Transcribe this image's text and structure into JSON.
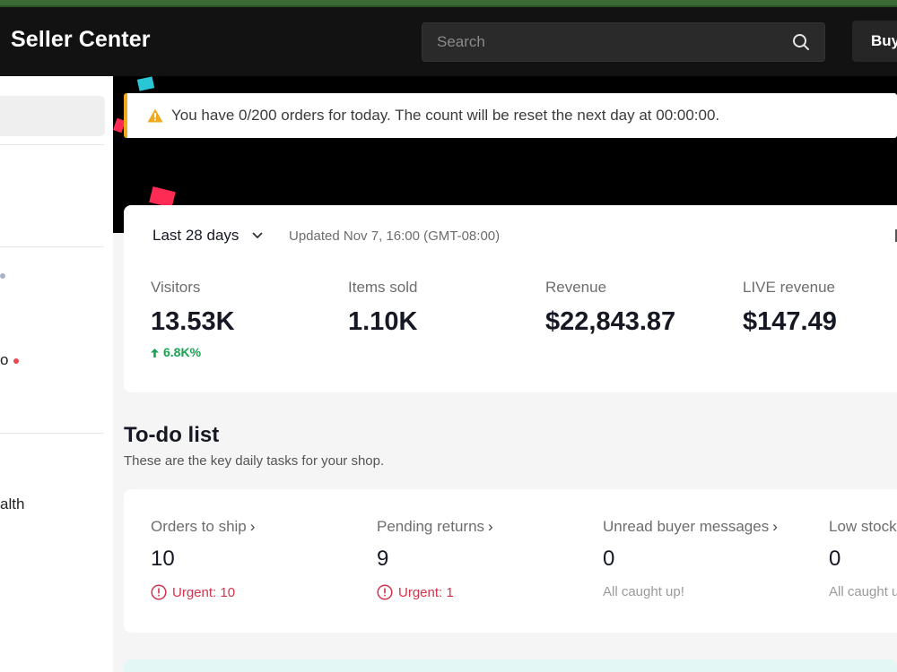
{
  "colors": {
    "topbar": "#121212",
    "accent_strip": "#3a6b34",
    "urgent": "#d5334d",
    "positive": "#1aa352",
    "warning": "#f0a91b",
    "confetti": [
      "#29c6d6",
      "#fe2c55"
    ]
  },
  "header": {
    "title": "Seller Center",
    "search_placeholder": "Search",
    "search_icon": "search-icon",
    "buy_button": "Buy"
  },
  "sidebar": {
    "fragments": [
      "o",
      "alth"
    ]
  },
  "notice": {
    "icon": "warning-icon",
    "text": "You have 0/200 orders for today. The count will be reset the next day at 00:00:00."
  },
  "stats": {
    "period": "Last 28 days",
    "updated": "Updated Nov 7, 16:00 (GMT-08:00)",
    "metrics": [
      {
        "label": "Visitors",
        "value": "13.53K",
        "change": "6.8K%"
      },
      {
        "label": "Items sold",
        "value": "1.10K"
      },
      {
        "label": "Revenue",
        "value": "$22,843.87"
      },
      {
        "label": "LIVE revenue",
        "value": "$147.49"
      }
    ]
  },
  "todo": {
    "title": "To-do list",
    "subtitle": "These are the key daily tasks for your shop.",
    "tasks": [
      {
        "label": "Orders to ship",
        "count": "10",
        "note": "Urgent: 10"
      },
      {
        "label": "Pending returns",
        "count": "9",
        "note": "Urgent: 1"
      },
      {
        "label": "Unread buyer messages",
        "count": "0",
        "note": "All caught up!"
      },
      {
        "label": "Low stock",
        "count": "0",
        "note": "All caught up!"
      }
    ]
  }
}
